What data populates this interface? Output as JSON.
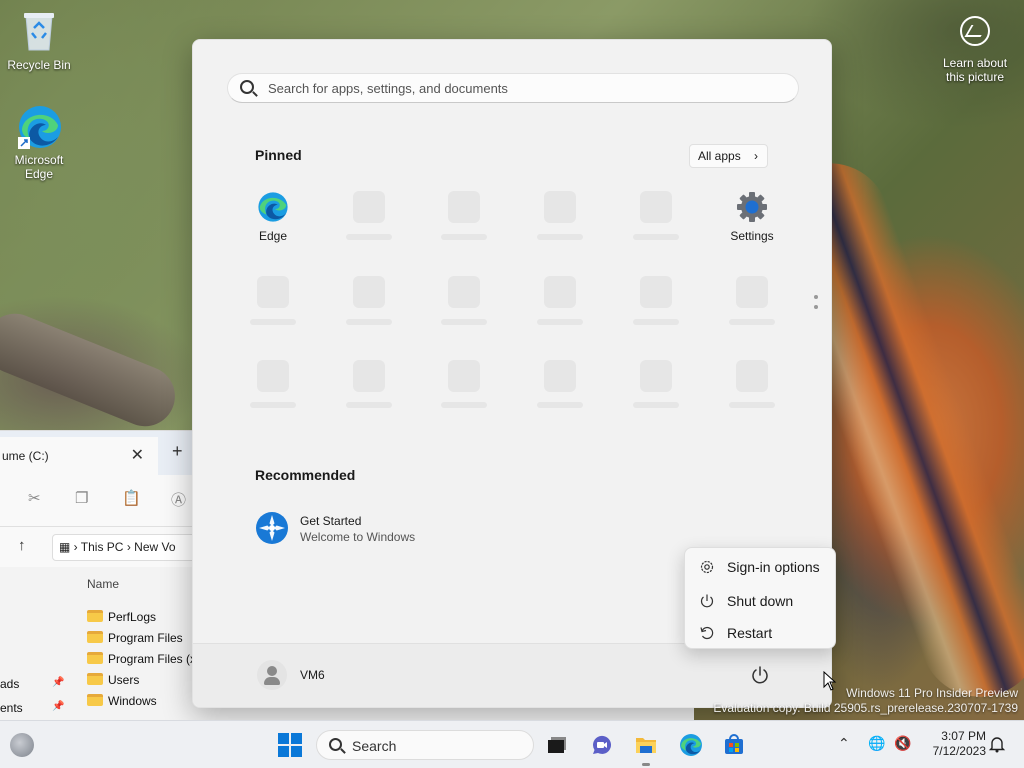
{
  "desktop": {
    "icons": [
      {
        "label": "Recycle Bin"
      },
      {
        "label": "Microsoft Edge"
      }
    ],
    "learn_about": "Learn about this picture",
    "watermark": {
      "line1": "Windows 11 Pro Insider Preview",
      "line2": "Evaluation copy. Build 25905.rs_prerelease.230707-1739"
    }
  },
  "explorer": {
    "tab_title": "ume (C:)",
    "breadcrumb": [
      "This PC",
      "New Vo"
    ],
    "column_header": "Name",
    "rows": [
      "PerfLogs",
      "Program Files",
      "Program Files (x",
      "Users",
      "Windows"
    ],
    "side_items": [
      "ads",
      "ents"
    ]
  },
  "start_menu": {
    "search_placeholder": "Search for apps, settings, and documents",
    "pinned_title": "Pinned",
    "all_apps_label": "All apps",
    "pinned_apps": [
      {
        "label": "Edge",
        "icon": "edge-icon"
      },
      {
        "label": "Settings",
        "icon": "gear-icon"
      }
    ],
    "recommended_title": "Recommended",
    "recommended": [
      {
        "title": "Get Started",
        "subtitle": "Welcome to Windows",
        "icon": "get-started-icon"
      }
    ],
    "user_name": "VM6"
  },
  "power_menu": {
    "items": [
      {
        "label": "Sign-in options",
        "icon": "gear-icon"
      },
      {
        "label": "Shut down",
        "icon": "power-icon"
      },
      {
        "label": "Restart",
        "icon": "restart-icon"
      }
    ]
  },
  "taskbar": {
    "search_label": "Search",
    "time": "3:07 PM",
    "date": "7/12/2023"
  },
  "colors": {
    "accent": "#0a78d8",
    "menu_bg": "#f2f2f2",
    "taskbar_bg": "#eef0f3"
  }
}
